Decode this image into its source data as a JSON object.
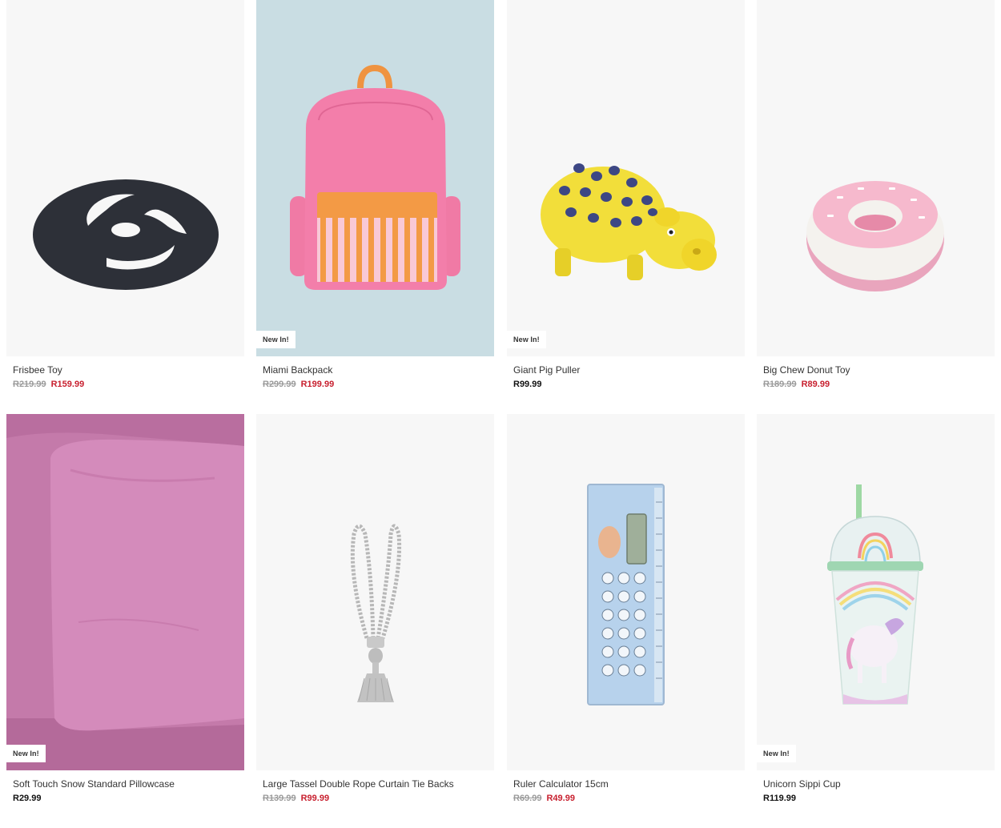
{
  "colors": {
    "sale": "#c8202f",
    "regular": "#111111",
    "strike": "#9b9b9b",
    "tile_bg": "#f7f7f7"
  },
  "products": [
    {
      "name": "Frisbee Toy",
      "was": "R219.99",
      "now": "R159.99",
      "on_sale": true,
      "badge": "",
      "image": "frisbee-image"
    },
    {
      "name": "Miami Backpack",
      "was": "R299.99",
      "now": "R199.99",
      "on_sale": true,
      "badge": "New In!",
      "image": "backpack-image"
    },
    {
      "name": "Giant Pig Puller",
      "was": "",
      "now": "R99.99",
      "on_sale": false,
      "badge": "New In!",
      "image": "pig-toy-image"
    },
    {
      "name": "Big Chew Donut Toy",
      "was": "R189.99",
      "now": "R89.99",
      "on_sale": true,
      "badge": "",
      "image": "donut-toy-image"
    },
    {
      "name": "Soft Touch Snow Standard Pillowcase",
      "was": "",
      "now": "R29.99",
      "on_sale": false,
      "badge": "New In!",
      "image": "pillowcase-image"
    },
    {
      "name": "Large Tassel Double Rope Curtain Tie Backs",
      "was": "R139.99",
      "now": "R99.99",
      "on_sale": true,
      "badge": "",
      "image": "tassel-tieback-image"
    },
    {
      "name": "Ruler Calculator 15cm",
      "was": "R69.99",
      "now": "R49.99",
      "on_sale": true,
      "badge": "",
      "image": "ruler-calculator-image"
    },
    {
      "name": "Unicorn Sippi Cup",
      "was": "",
      "now": "R119.99",
      "on_sale": false,
      "badge": "New In!",
      "image": "unicorn-cup-image"
    }
  ]
}
